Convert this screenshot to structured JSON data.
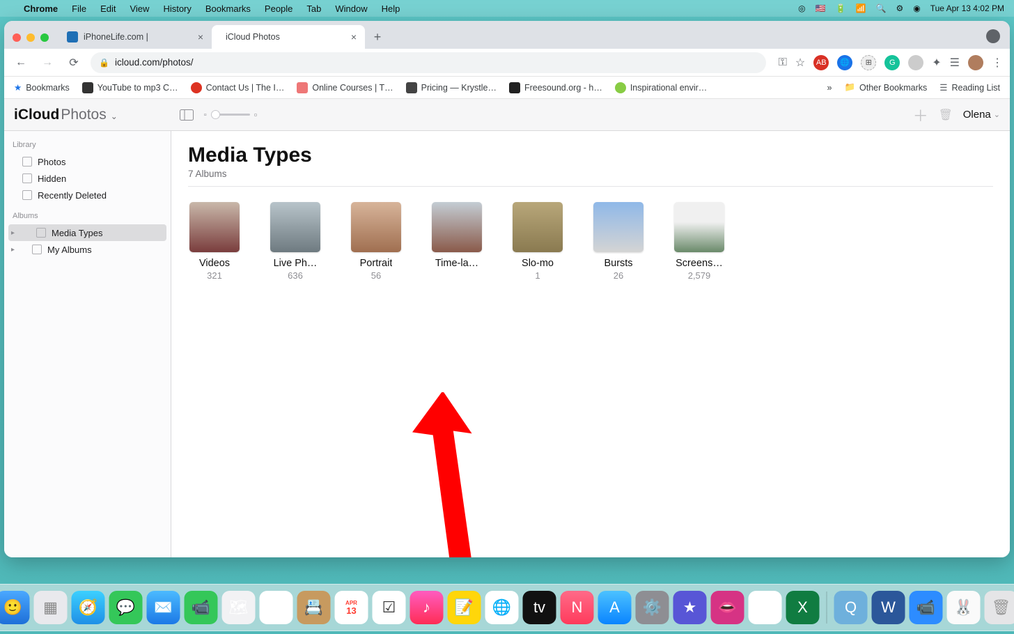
{
  "menubar": {
    "app": "Chrome",
    "items": [
      "File",
      "Edit",
      "View",
      "History",
      "Bookmarks",
      "People",
      "Tab",
      "Window",
      "Help"
    ],
    "clock": "Tue Apr 13  4:02 PM"
  },
  "tabs": [
    {
      "title": "iPhoneLife.com |",
      "active": false
    },
    {
      "title": "iCloud Photos",
      "active": true
    }
  ],
  "url": "icloud.com/photos/",
  "bookmarks_bar": {
    "items": [
      {
        "label": "Bookmarks"
      },
      {
        "label": "YouTube to mp3 C…"
      },
      {
        "label": "Contact Us | The I…"
      },
      {
        "label": "Online Courses | T…"
      },
      {
        "label": "Pricing — Krystle…"
      },
      {
        "label": "Freesound.org - h…"
      },
      {
        "label": "Inspirational envir…"
      }
    ],
    "overflow": "»",
    "other": "Other Bookmarks",
    "reading": "Reading List"
  },
  "icloud": {
    "brand_bold": "iCloud",
    "brand_thin": "Photos",
    "user": "Olena",
    "sidebar": {
      "library_head": "Library",
      "library": [
        "Photos",
        "Hidden",
        "Recently Deleted"
      ],
      "albums_head": "Albums",
      "albums": [
        "Media Types",
        "My Albums"
      ],
      "selected": "Media Types"
    },
    "main": {
      "title": "Media Types",
      "subtitle": "7 Albums",
      "albums": [
        {
          "name": "Videos",
          "count": "321"
        },
        {
          "name": "Live Ph…",
          "count": "636"
        },
        {
          "name": "Portrait",
          "count": "56"
        },
        {
          "name": "Time-la…",
          "count": ""
        },
        {
          "name": "Slo-mo",
          "count": "1"
        },
        {
          "name": "Bursts",
          "count": "26"
        },
        {
          "name": "Screens…",
          "count": "2,579"
        }
      ]
    }
  }
}
